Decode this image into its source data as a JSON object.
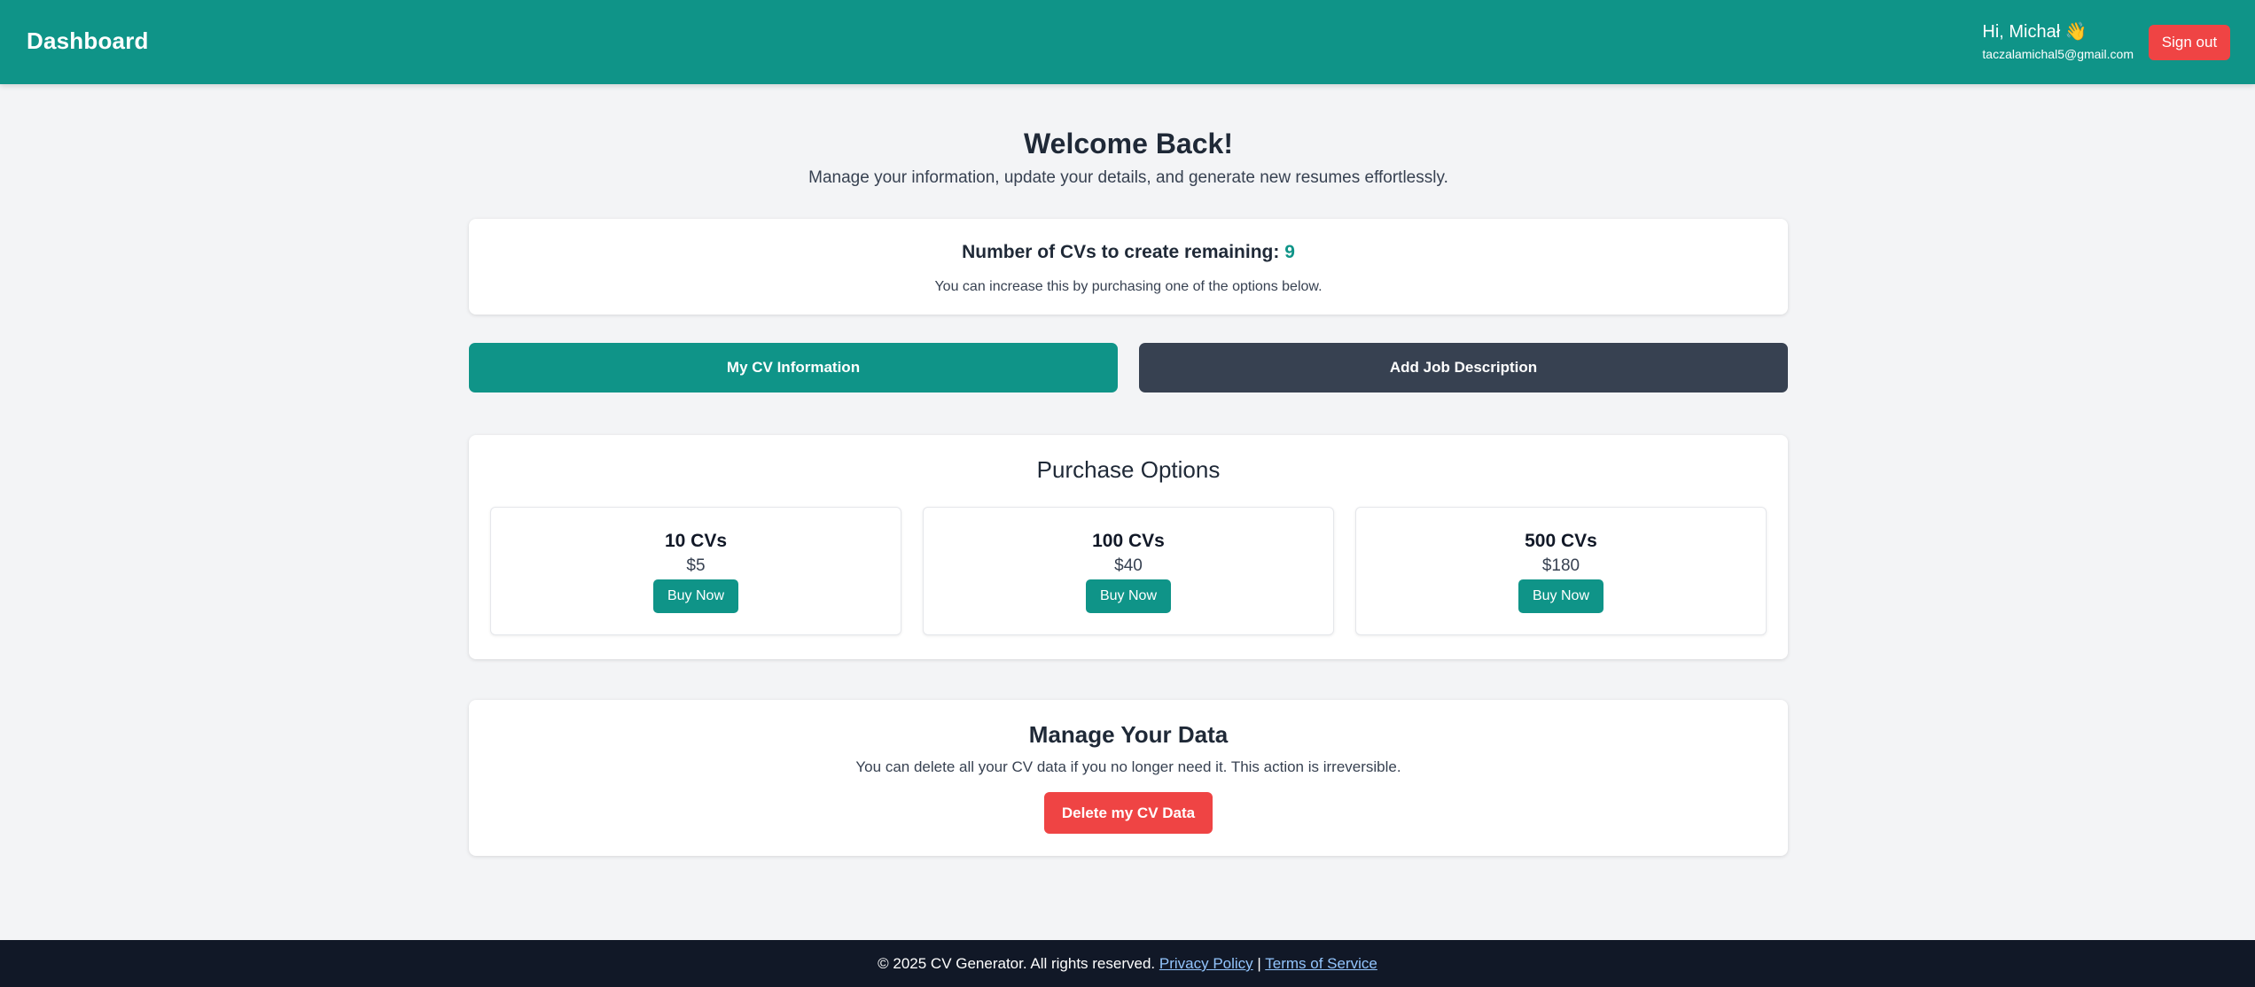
{
  "header": {
    "brand": "Dashboard",
    "greeting": "Hi, Michał 👋",
    "email": "taczalamichal5@gmail.com",
    "signout_label": "Sign out"
  },
  "welcome": {
    "title": "Welcome Back!",
    "subtitle": "Manage your information, update your details, and generate new resumes effortlessly."
  },
  "remaining": {
    "label": "Number of CVs to create remaining:",
    "count": "9",
    "note": "You can increase this by purchasing one of the options below."
  },
  "actions": {
    "cv_info_label": "My CV Information",
    "job_desc_label": "Add Job Description"
  },
  "purchase": {
    "title": "Purchase Options",
    "options": [
      {
        "name": "10 CVs",
        "price": "$5",
        "button": "Buy Now"
      },
      {
        "name": "100 CVs",
        "price": "$40",
        "button": "Buy Now"
      },
      {
        "name": "500 CVs",
        "price": "$180",
        "button": "Buy Now"
      }
    ]
  },
  "manage": {
    "title": "Manage Your Data",
    "note": "You can delete all your CV data if you no longer need it. This action is irreversible.",
    "delete_label": "Delete my CV Data"
  },
  "footer": {
    "copyright": "© 2025 CV Generator. All rights reserved.",
    "privacy_label": "Privacy Policy",
    "separator": "|",
    "terms_label": "Terms of Service"
  },
  "colors": {
    "primary": "#0f9488",
    "danger": "#ef4444",
    "dark_button": "#374151",
    "footer_bg": "#111827",
    "link": "#93c5fd",
    "page_bg": "#f3f4f6"
  }
}
